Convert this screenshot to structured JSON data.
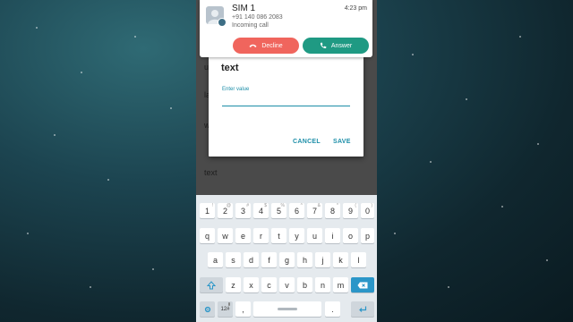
{
  "notification": {
    "title": "SIM 1",
    "time": "4:23 pm",
    "number": "+91 140 086 2083",
    "status": "Incoming call",
    "decline_label": "Decline",
    "answer_label": "Answer",
    "decline_color": "#f0655d",
    "answer_color": "#1f9a83"
  },
  "background_app": {
    "list_fragments": [
      "u",
      "la",
      "w"
    ],
    "bottom_text": "text"
  },
  "dialog": {
    "title": "text",
    "input_hint": "Enter value",
    "input_value": "",
    "cancel_label": "CANCEL",
    "save_label": "SAVE",
    "accent_color": "#1c8ea8"
  },
  "keyboard": {
    "row1": [
      {
        "k": "1",
        "h": "!"
      },
      {
        "k": "2",
        "h": "@"
      },
      {
        "k": "3",
        "h": "#"
      },
      {
        "k": "4",
        "h": "$"
      },
      {
        "k": "5",
        "h": "%"
      },
      {
        "k": "6",
        "h": "^"
      },
      {
        "k": "7",
        "h": "&"
      },
      {
        "k": "8",
        "h": "*"
      },
      {
        "k": "9",
        "h": "("
      },
      {
        "k": "0",
        "h": ")"
      }
    ],
    "row2": [
      "q",
      "w",
      "e",
      "r",
      "t",
      "y",
      "u",
      "i",
      "o",
      "p"
    ],
    "row3": [
      "a",
      "s",
      "d",
      "f",
      "g",
      "h",
      "j",
      "k",
      "l"
    ],
    "row4": [
      "z",
      "x",
      "c",
      "v",
      "b",
      "n",
      "m"
    ],
    "shift_icon": "shift-up-arrow-icon",
    "backspace_icon": "backspace-icon",
    "enter_icon": "enter-return-icon",
    "settings_icon": "gear-icon",
    "mic_icon": "microphone-icon",
    "period": ".",
    "comma": ",",
    "symbol_toggle": "12#"
  }
}
